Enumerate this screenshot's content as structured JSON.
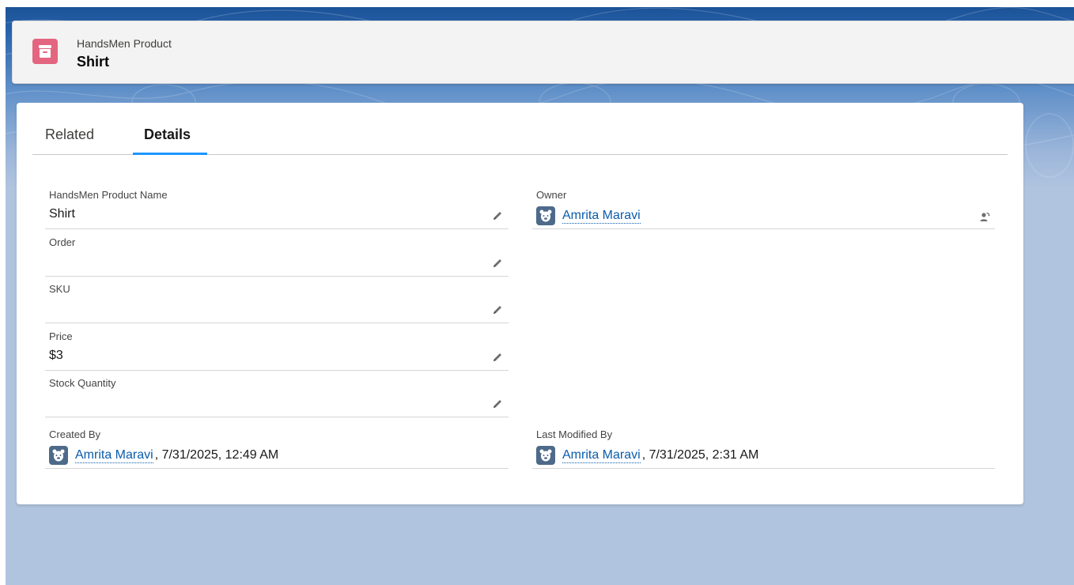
{
  "header": {
    "object_type": "HandsMen Product",
    "record_title": "Shirt",
    "icon_color": "#e3657f"
  },
  "tabs": [
    {
      "label": "Related",
      "active": false
    },
    {
      "label": "Details",
      "active": true
    }
  ],
  "fields": {
    "product_name": {
      "label": "HandsMen Product Name",
      "value": "Shirt"
    },
    "order": {
      "label": "Order",
      "value": ""
    },
    "sku": {
      "label": "SKU",
      "value": ""
    },
    "price": {
      "label": "Price",
      "value": "$3"
    },
    "stock_quantity": {
      "label": "Stock Quantity",
      "value": ""
    },
    "owner": {
      "label": "Owner",
      "user": "Amrita Maravi"
    },
    "created_by": {
      "label": "Created By",
      "user": "Amrita Maravi",
      "timestamp": "7/31/2025, 12:49 AM"
    },
    "last_modified_by": {
      "label": "Last Modified By",
      "user": "Amrita Maravi",
      "timestamp": "7/31/2025, 2:31 AM"
    }
  },
  "colors": {
    "link": "#0b5cab",
    "active_tab_underline": "#1b96ff",
    "avatar_bg": "#4e6a8b"
  },
  "icons": {
    "object": "archive-box-icon",
    "edit": "pencil-icon",
    "change_owner": "change-owner-icon",
    "avatar": "bear-avatar-icon"
  }
}
